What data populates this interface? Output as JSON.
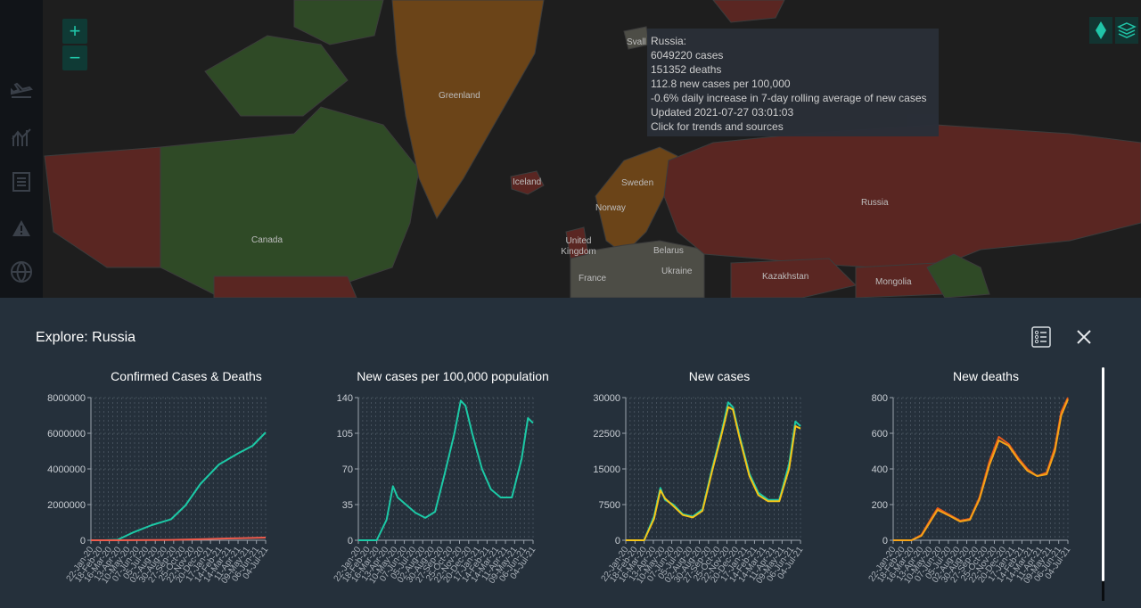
{
  "map": {
    "zoom_in": "+",
    "zoom_out": "−",
    "labels": [
      {
        "key": "greenland",
        "text": "Greenland"
      },
      {
        "key": "svalbard",
        "text": "Svall"
      },
      {
        "key": "iceland",
        "text": "Iceland"
      },
      {
        "key": "sweden",
        "text": "Sweden"
      },
      {
        "key": "norway",
        "text": "Norway"
      },
      {
        "key": "united_kingdom",
        "text": "United Kingdom"
      },
      {
        "key": "belarus",
        "text": "Belarus"
      },
      {
        "key": "ukraine",
        "text": "Ukraine"
      },
      {
        "key": "france",
        "text": "France"
      },
      {
        "key": "kazakhstan",
        "text": "Kazakhstan"
      },
      {
        "key": "mongolia",
        "text": "Mongolia"
      },
      {
        "key": "russia",
        "text": "Russia"
      },
      {
        "key": "canada",
        "text": "Canada"
      }
    ],
    "colors": {
      "red": "#5a2622",
      "green": "#2f4a26",
      "orange": "#6b4418",
      "gray": "#4d4d46",
      "background": "#1e1e1e",
      "accent": "#20c5a8"
    }
  },
  "sidebar": {
    "icons": [
      "airplane-icon",
      "trends-icon",
      "list-icon",
      "warning-icon",
      "globe-icon"
    ]
  },
  "tooltip": {
    "lines": [
      "Russia:",
      "6049220 cases",
      "151352 deaths",
      "112.8 new cases per 100,000",
      "-0.6% daily increase in 7-day rolling average of new cases",
      "Updated 2021-07-27 03:01:03",
      "Click for trends and sources"
    ]
  },
  "panel": {
    "title": "Explore: Russia",
    "x_tick_labels": [
      "22-Jan-20",
      "18-Feb-20",
      "16-Mar-20",
      "13-Apr-20",
      "10-May-20",
      "07-Jun-20",
      "05-Jul-20",
      "02-Aug-20",
      "30-Aug-20",
      "27-Sep-20",
      "25-Oct-20",
      "22-Nov-20",
      "20-Dec-20",
      "17-Jan-21",
      "14-Feb-21",
      "14-Mar-21",
      "11-Apr-21",
      "09-May-21",
      "06-Jun-21",
      "04-Jul-21"
    ]
  },
  "chart_data": [
    {
      "type": "line",
      "title": "Confirmed Cases & Deaths",
      "xlabel": "",
      "ylabel": "",
      "ylim": [
        0,
        8000000
      ],
      "y_ticks": [
        "8000000",
        "6000000",
        "4000000",
        "2000000",
        "0"
      ],
      "x": [
        "2020-01-22",
        "2020-03-01",
        "2020-04-15",
        "2020-06-01",
        "2020-08-01",
        "2020-10-01",
        "2020-11-15",
        "2021-01-01",
        "2021-03-01",
        "2021-05-01",
        "2021-06-15",
        "2021-07-26"
      ],
      "series": [
        {
          "color": "#1cc9a6",
          "values": [
            0,
            0,
            25000,
            420000,
            850000,
            1180000,
            1950000,
            3150000,
            4250000,
            4880000,
            5300000,
            6049220
          ]
        },
        {
          "color": "#ef5b4c",
          "values": [
            0,
            0,
            200,
            5000,
            14000,
            21000,
            34000,
            57000,
            90000,
            113000,
            128000,
            151352
          ]
        }
      ],
      "grid": true
    },
    {
      "type": "line",
      "title": "New cases per 100,000 population",
      "xlabel": "",
      "ylabel": "",
      "ylim": [
        0,
        140
      ],
      "y_ticks": [
        "140",
        "105",
        "70",
        "35",
        "0"
      ],
      "x": [
        "2020-01-22",
        "2020-03-20",
        "2020-04-20",
        "2020-05-10",
        "2020-05-25",
        "2020-06-20",
        "2020-07-20",
        "2020-08-20",
        "2020-09-20",
        "2020-10-20",
        "2020-11-20",
        "2020-12-10",
        "2020-12-25",
        "2021-01-15",
        "2021-02-15",
        "2021-03-15",
        "2021-04-15",
        "2021-05-20",
        "2021-06-20",
        "2021-07-10",
        "2021-07-26"
      ],
      "series": [
        {
          "color": "#1cc9a6",
          "values": [
            0,
            0,
            20,
            53,
            42,
            35,
            27,
            22,
            28,
            65,
            105,
            137,
            132,
            105,
            70,
            50,
            42,
            42,
            80,
            120,
            115
          ]
        }
      ],
      "grid": true
    },
    {
      "type": "line",
      "title": "New cases",
      "xlabel": "",
      "ylabel": "",
      "ylim": [
        0,
        30000
      ],
      "y_ticks": [
        "30000",
        "22500",
        "15000",
        "7500",
        "0"
      ],
      "x": [
        "2020-01-22",
        "2020-03-20",
        "2020-04-20",
        "2020-05-10",
        "2020-05-25",
        "2020-06-20",
        "2020-07-20",
        "2020-08-20",
        "2020-09-20",
        "2020-10-20",
        "2020-11-20",
        "2020-12-10",
        "2020-12-25",
        "2021-01-15",
        "2021-02-15",
        "2021-03-15",
        "2021-04-15",
        "2021-05-20",
        "2021-06-20",
        "2021-07-10",
        "2021-07-26"
      ],
      "series": [
        {
          "color": "#1cc9a6",
          "values": [
            0,
            0,
            5000,
            11000,
            8500,
            7500,
            5500,
            5000,
            6500,
            15000,
            23000,
            29000,
            28000,
            22000,
            14000,
            10000,
            8500,
            8500,
            16000,
            25000,
            24000
          ]
        },
        {
          "color": "#f5c518",
          "values": [
            0,
            0,
            4500,
            10500,
            8800,
            7200,
            5300,
            4800,
            6200,
            14500,
            22500,
            28000,
            27500,
            21500,
            13500,
            9500,
            8200,
            8200,
            15000,
            24000,
            23500
          ]
        }
      ],
      "grid": true
    },
    {
      "type": "line",
      "title": "New deaths",
      "xlabel": "",
      "ylabel": "",
      "ylim": [
        0,
        800
      ],
      "y_ticks": [
        "800",
        "600",
        "400",
        "200",
        "0"
      ],
      "x": [
        "2020-01-22",
        "2020-03-20",
        "2020-04-20",
        "2020-05-20",
        "2020-06-10",
        "2020-07-20",
        "2020-08-20",
        "2020-09-20",
        "2020-10-20",
        "2020-11-20",
        "2020-12-20",
        "2021-01-20",
        "2021-02-20",
        "2021-03-20",
        "2021-04-20",
        "2021-05-20",
        "2021-06-15",
        "2021-07-05",
        "2021-07-26"
      ],
      "series": [
        {
          "color": "#e95b1a",
          "values": [
            0,
            0,
            30,
            120,
            180,
            140,
            110,
            120,
            240,
            440,
            580,
            540,
            460,
            400,
            360,
            380,
            520,
            720,
            800
          ]
        },
        {
          "color": "#f5a418",
          "values": [
            0,
            0,
            25,
            110,
            170,
            135,
            105,
            115,
            230,
            420,
            560,
            530,
            450,
            390,
            360,
            370,
            500,
            700,
            790
          ]
        }
      ],
      "grid": true
    }
  ]
}
